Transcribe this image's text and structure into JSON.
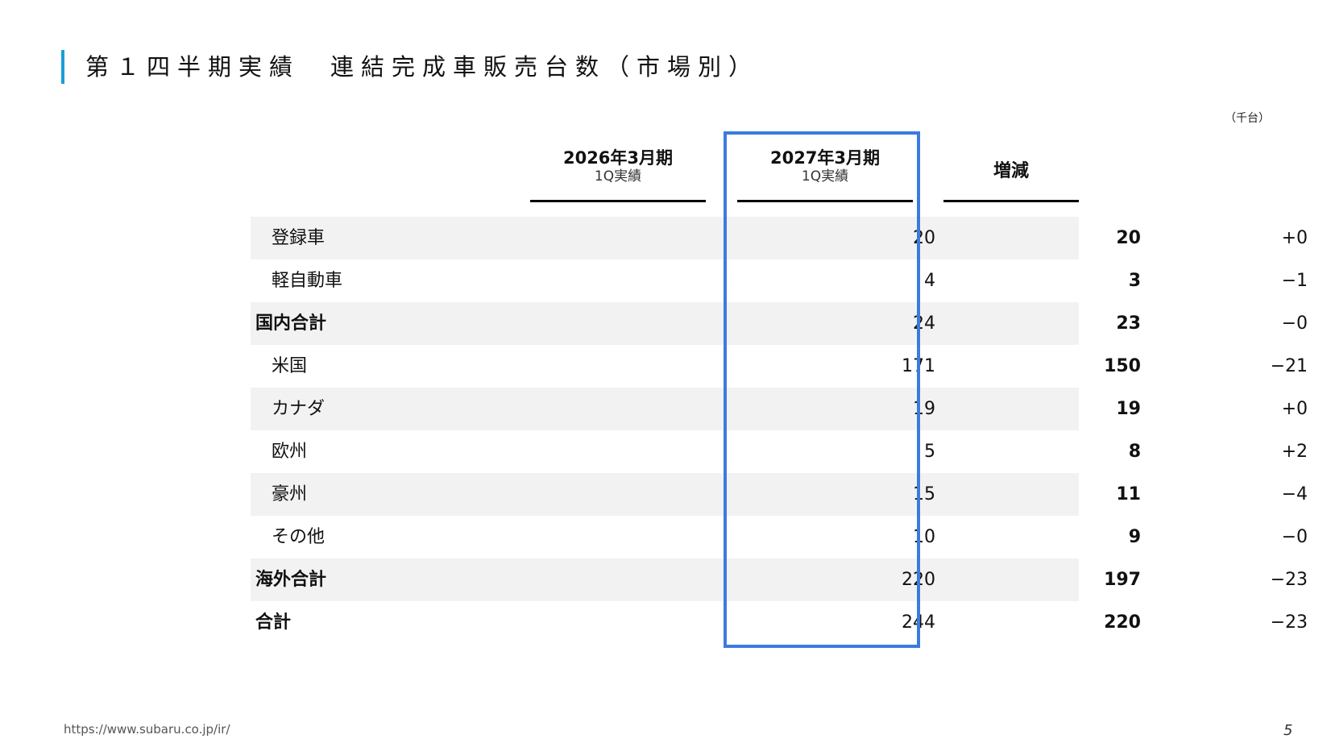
{
  "title": "第１四半期実績　連結完成車販売台数（市場別）",
  "unit": "（千台）",
  "columns": {
    "prev": {
      "main": "2026年3月期",
      "sub": "1Q実績"
    },
    "curr": {
      "main": "2027年3月期",
      "sub": "1Q実績"
    },
    "diff": {
      "main": "増減"
    }
  },
  "rows": [
    {
      "label": "登録車",
      "prev": "20",
      "curr": "20",
      "diff": "+0"
    },
    {
      "label": "軽自動車",
      "prev": "4",
      "curr": "3",
      "diff": "−1"
    },
    {
      "label": "国内合計",
      "prev": "24",
      "curr": "23",
      "diff": "−0"
    },
    {
      "label": "米国",
      "prev": "171",
      "curr": "150",
      "diff": "−21"
    },
    {
      "label": "カナダ",
      "prev": "19",
      "curr": "19",
      "diff": "+0"
    },
    {
      "label": "欧州",
      "prev": "5",
      "curr": "8",
      "diff": "+2"
    },
    {
      "label": "豪州",
      "prev": "15",
      "curr": "11",
      "diff": "−4"
    },
    {
      "label": "その他",
      "prev": "10",
      "curr": "9",
      "diff": "−0"
    },
    {
      "label": "海外合計",
      "prev": "220",
      "curr": "197",
      "diff": "−23"
    },
    {
      "label": "合計",
      "prev": "244",
      "curr": "220",
      "diff": "−23"
    }
  ],
  "footer": {
    "url": "https://www.subaru.co.jp/ir/",
    "page": "5"
  },
  "colors": {
    "accent_bar": "#1a9ed8",
    "highlight_border": "#3a7be0",
    "row_shade": "#f2f2f2"
  }
}
